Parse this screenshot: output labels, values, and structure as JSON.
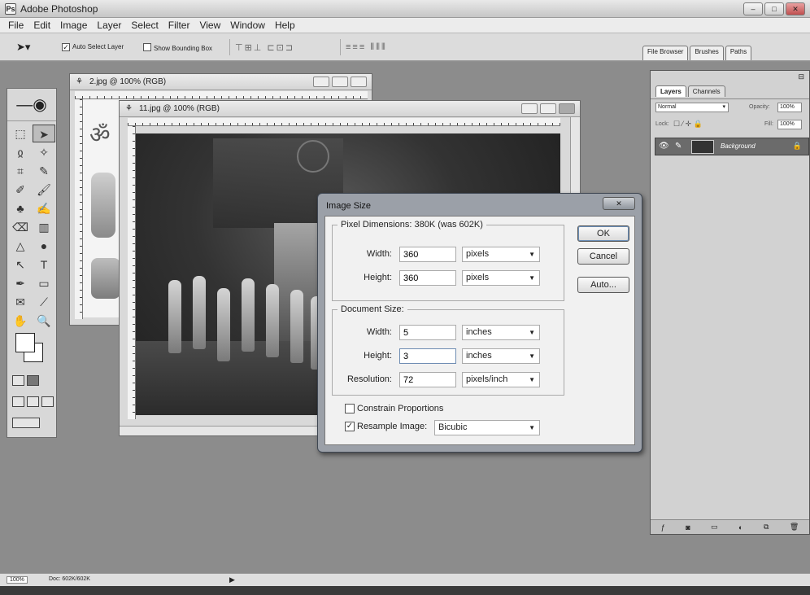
{
  "app": {
    "title": "Adobe Photoshop",
    "icon_glyph": "Ps"
  },
  "menu": [
    "File",
    "Edit",
    "Image",
    "Layer",
    "Select",
    "Filter",
    "View",
    "Window",
    "Help"
  ],
  "options_bar": {
    "auto_select_layer": "Auto Select Layer",
    "auto_select_checked": true,
    "show_bounding_box": "Show Bounding Box",
    "show_bounding_checked": false
  },
  "palette_well": [
    "File Browser",
    "Brushes",
    "Paths"
  ],
  "documents": {
    "back": {
      "title": "2.jpg @ 100% (RGB)"
    },
    "front": {
      "title": "11.jpg @ 100% (RGB)"
    }
  },
  "dialog": {
    "title": "Image Size",
    "pixel_dimensions": {
      "legend": "Pixel Dimensions:  380K (was 602K)",
      "width_label": "Width:",
      "width_value": "360",
      "width_unit": "pixels",
      "height_label": "Height:",
      "height_value": "360",
      "height_unit": "pixels"
    },
    "document_size": {
      "legend": "Document Size:",
      "width_label": "Width:",
      "width_value": "5",
      "width_unit": "inches",
      "height_label": "Height:",
      "height_value": "3",
      "height_unit": "inches",
      "resolution_label": "Resolution:",
      "resolution_value": "72",
      "resolution_unit": "pixels/inch"
    },
    "constrain_proportions": "Constrain Proportions",
    "constrain_checked": false,
    "resample_image": "Resample Image:",
    "resample_checked": true,
    "resample_method": "Bicubic",
    "buttons": {
      "ok": "OK",
      "cancel": "Cancel",
      "auto": "Auto..."
    }
  },
  "layers_palette": {
    "tabs": [
      "Layers",
      "Channels"
    ],
    "blend_mode": "Normal",
    "opacity_label": "Opacity:",
    "opacity_value": "100%",
    "lock_label": "Lock:",
    "fill_label": "Fill:",
    "fill_value": "100%",
    "layer_name": "Background"
  },
  "status": {
    "zoom": "100%",
    "doc_info": "Doc: 602K/602K"
  }
}
